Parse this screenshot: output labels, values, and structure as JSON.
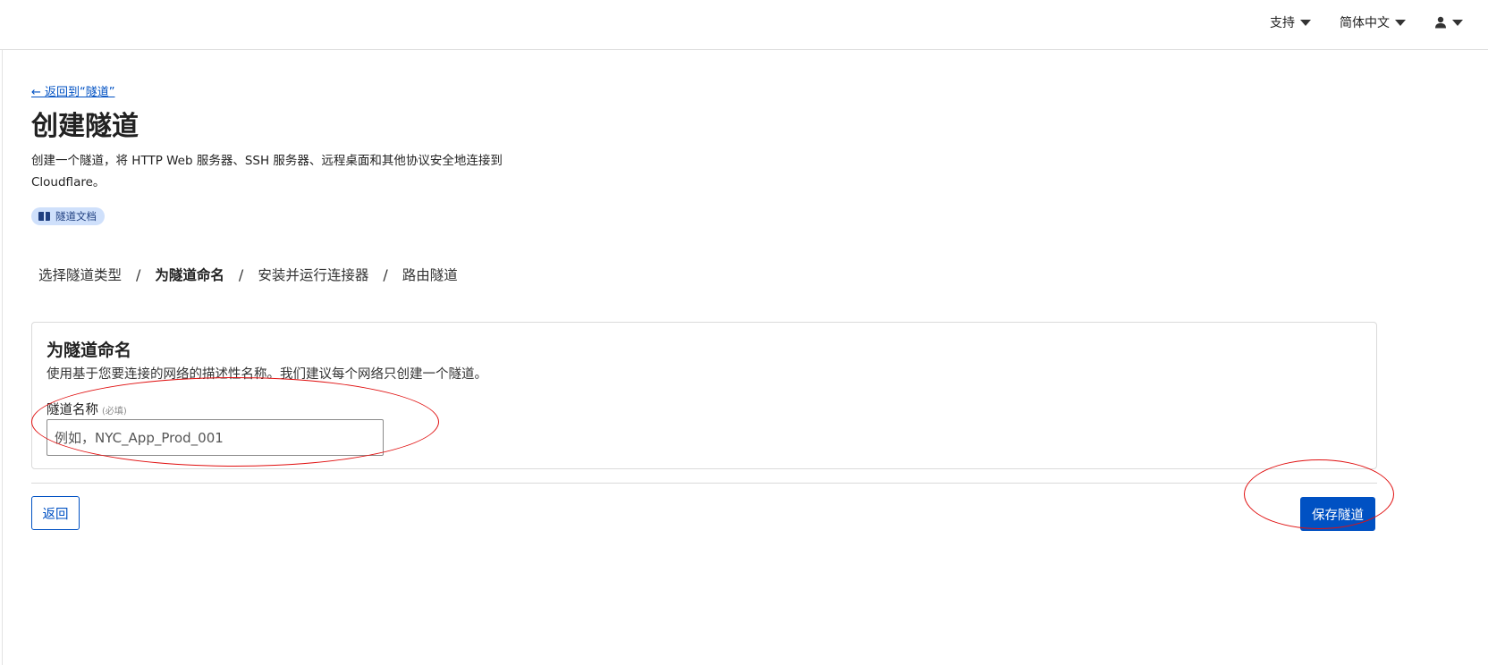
{
  "header": {
    "support_label": "支持",
    "language_label": "简体中文"
  },
  "page": {
    "back_link": "← 返回到“隧道”",
    "title": "创建隧道",
    "description": "创建一个隧道，将 HTTP Web 服务器、SSH 服务器、远程桌面和其他协议安全地连接到 Cloudflare。",
    "docs_badge": "隧道文档"
  },
  "steps": [
    {
      "label": "选择隧道类型",
      "current": false
    },
    {
      "label": "为隧道命名",
      "current": true
    },
    {
      "label": "安装并运行连接器",
      "current": false
    },
    {
      "label": "路由隧道",
      "current": false
    }
  ],
  "step_separator": "/",
  "card": {
    "title": "为隧道命名",
    "description": "使用基于您要连接的网络的描述性名称。我们建议每个网络只创建一个隧道。",
    "field_label": "隧道名称",
    "field_required": "(必填)",
    "input_value": "",
    "input_placeholder": "例如，NYC_App_Prod_001"
  },
  "actions": {
    "back_label": "返回",
    "save_label": "保存隧道"
  },
  "colors": {
    "accent": "#0051c3",
    "annotation": "#e01010",
    "badge_bg": "#cfe0fb"
  }
}
